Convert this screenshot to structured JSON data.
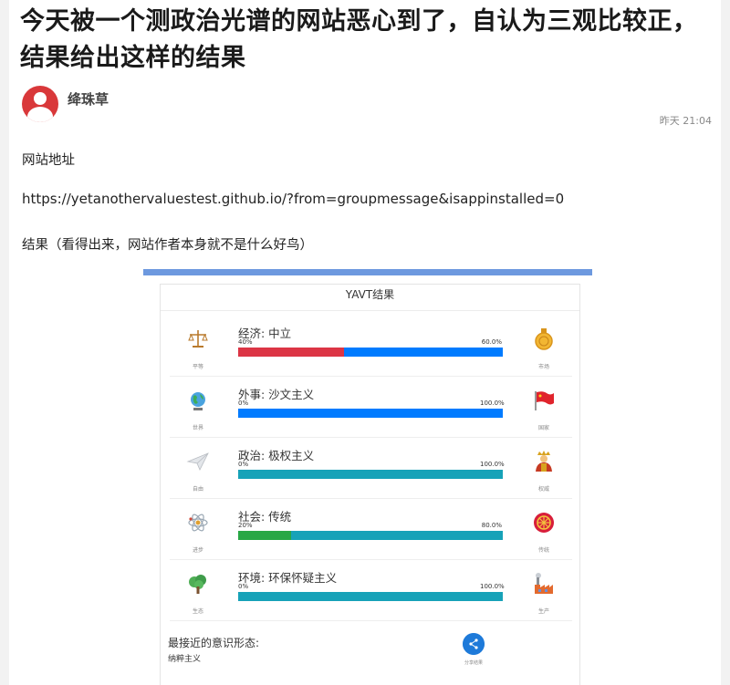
{
  "post": {
    "title": "今天被一个测政治光谱的网站恶心到了，自认为三观比较正，结果给出这样的结果",
    "author": "绛珠草",
    "time": "昨天 21:04",
    "paragraphs": [
      "网站地址",
      "https://yetanothervaluestest.github.io/?from=groupmessage&isappinstalled=0",
      "结果（看得出来，网站作者本身就不是什么好鸟）"
    ]
  },
  "result": {
    "title": "YAVT结果",
    "axes": [
      {
        "label": "经济: 中立",
        "left_pct": "40%",
        "right_pct": "60.0%",
        "left_value": 40,
        "right_value": 60,
        "left_color": "#dc3545",
        "right_color": "#007bff",
        "left_caption": "平等",
        "right_caption": "市场",
        "left_icon": "scales-icon",
        "right_icon": "coin-icon"
      },
      {
        "label": "外事: 沙文主义",
        "left_pct": "0%",
        "right_pct": "100.0%",
        "left_value": 0,
        "right_value": 100,
        "left_color": "#28a745",
        "right_color": "#007bff",
        "left_caption": "世界",
        "right_caption": "国家",
        "left_icon": "globe-icon",
        "right_icon": "flag-icon"
      },
      {
        "label": "政治: 极权主义",
        "left_pct": "0%",
        "right_pct": "100.0%",
        "left_value": 0,
        "right_value": 100,
        "left_color": "#28a745",
        "right_color": "#17a2b8",
        "left_caption": "自由",
        "right_caption": "权威",
        "left_icon": "paper-plane-icon",
        "right_icon": "emperor-icon"
      },
      {
        "label": "社会: 传统",
        "left_pct": "20%",
        "right_pct": "80.0%",
        "left_value": 20,
        "right_value": 80,
        "left_color": "#28a745",
        "right_color": "#17a2b8",
        "left_caption": "进步",
        "right_caption": "传统",
        "left_icon": "atom-icon",
        "right_icon": "wheel-icon"
      },
      {
        "label": "环境: 环保怀疑主义",
        "left_pct": "0%",
        "right_pct": "100.0%",
        "left_value": 0,
        "right_value": 100,
        "left_color": "#28a745",
        "right_color": "#17a2b8",
        "left_caption": "生态",
        "right_caption": "生产",
        "left_icon": "tree-icon",
        "right_icon": "factory-icon"
      }
    ],
    "ideology_label": "最接近的意识形态:",
    "ideology_value": "纳粹主义",
    "share_caption": "分享结果"
  }
}
